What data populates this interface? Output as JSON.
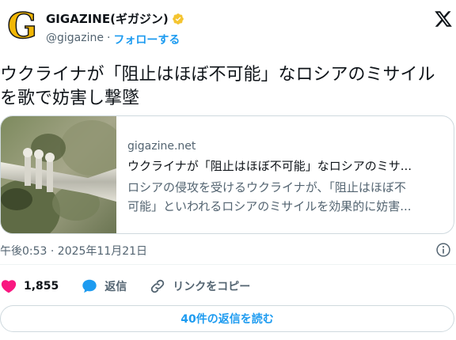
{
  "author": {
    "name": "GIGAZINE(ギガジン)",
    "avatar_letter": "G",
    "handle": "@gigazine",
    "separator": "·",
    "follow_label": "フォローする",
    "verified_color": "#f4c430"
  },
  "platform_icon": "x-logo-icon",
  "tweet": {
    "line1": "ウクライナが「阻止はほぼ不可能」なロシアのミサイル",
    "line2": "を歌で妨害し撃墜"
  },
  "card": {
    "domain": "gigazine.net",
    "title": "ウクライナが「阻止はほぼ不可能」なロシアのミサ...",
    "description_line1": "ロシアの侵攻を受けるウクライナが、「阻止はほぼ不",
    "description_line2": "可能」といわれるロシアのミサイルを効果的に妨害..."
  },
  "meta": {
    "timestamp": "午後0:53 · 2025年11月21日"
  },
  "actions": {
    "likes_count": "1,855",
    "reply_label": "返信",
    "copy_link_label": "リンクをコピー"
  },
  "read_replies_label": "40件の返信を読む",
  "colors": {
    "accent": "#1d9bf0",
    "like": "#f91880",
    "secondary_text": "#536471"
  }
}
